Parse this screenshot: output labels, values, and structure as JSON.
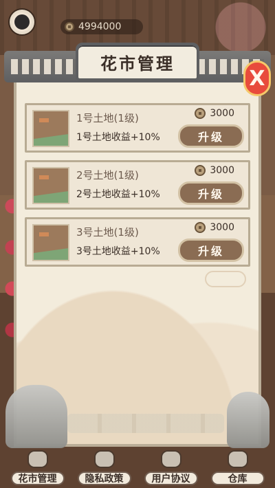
{
  "header": {
    "coins": "4994000"
  },
  "panel": {
    "title": "花市管理",
    "close_label": "X"
  },
  "lands": [
    {
      "name": "1号土地(1级)",
      "bonus": "1号土地收益+10%",
      "cost": "3000",
      "button": "升级"
    },
    {
      "name": "2号土地(1级)",
      "bonus": "2号土地收益+10%",
      "cost": "3000",
      "button": "升级"
    },
    {
      "name": "3号土地(1级)",
      "bonus": "3号土地收益+10%",
      "cost": "3000",
      "button": "升级"
    }
  ],
  "bottom_nav": [
    {
      "label": "花市管理",
      "icon": "market-icon"
    },
    {
      "label": "隐私政策",
      "icon": "privacy-icon"
    },
    {
      "label": "用户协议",
      "icon": "agreement-icon"
    },
    {
      "label": "仓库",
      "icon": "warehouse-icon"
    }
  ]
}
